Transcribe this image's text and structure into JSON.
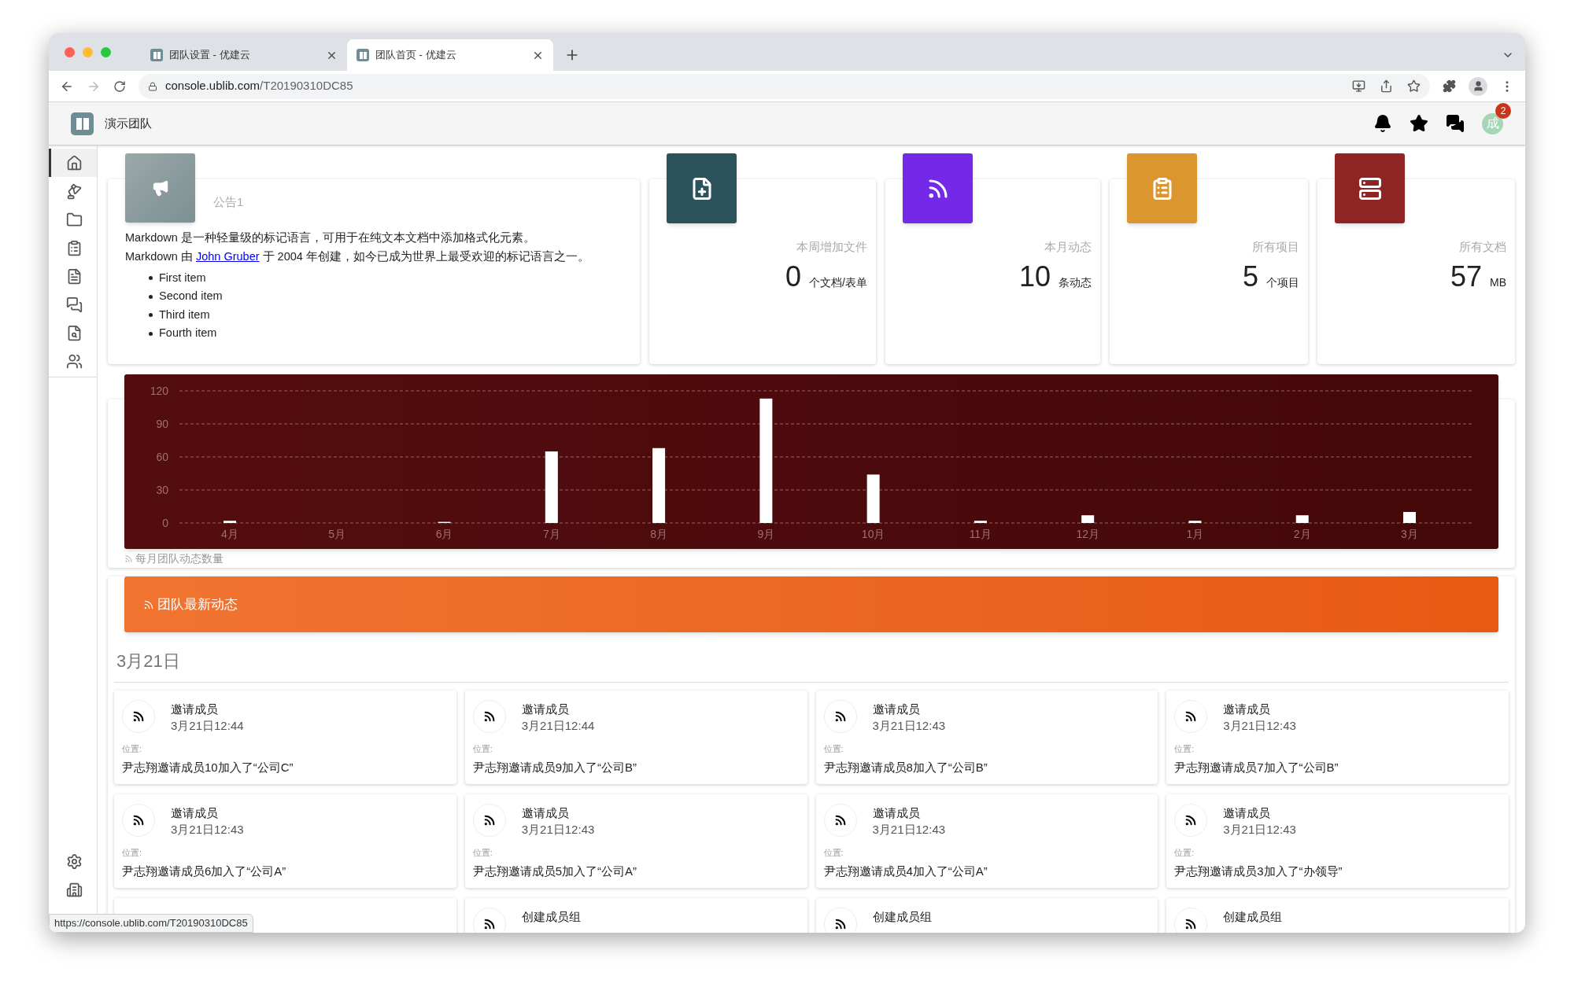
{
  "browser": {
    "tabs": [
      {
        "title": "团队设置 - 优建云",
        "selected": false
      },
      {
        "title": "团队首页 - 优建云",
        "selected": true
      }
    ],
    "url_host": "console.ublib.com",
    "url_path": "/T20190310DC85",
    "status_url": "https://console.ublib.com/T20190310DC85"
  },
  "app_header": {
    "team_name": "演示团队",
    "avatar": "成",
    "badge": "2"
  },
  "sidebar": {
    "items": [
      {
        "selected": true
      },
      {
        "selected": false
      },
      {
        "selected": false
      },
      {
        "selected": false
      },
      {
        "selected": false
      },
      {
        "selected": false
      },
      {
        "selected": false
      },
      {
        "selected": false
      }
    ],
    "bottom_items": [
      {
        "selected": false
      },
      {
        "selected": false
      }
    ]
  },
  "announcement": {
    "title": "公告1",
    "line_1": "Markdown 是一种轻量级的标记语言，可用于在纯文本文档中添加格式化元素。",
    "line_2_before": "Markdown 由 ",
    "line_2_link": "John Gruber",
    "line_2_after": " 于 2004 年创建，如今已成为世界上最受欢迎的标记语言之一。",
    "list": [
      "First item",
      "Second item",
      "Third item",
      "Fourth item"
    ]
  },
  "stats": [
    {
      "label": "本周增加文件",
      "value": "0",
      "unit": "个文档/表单",
      "color": "#2c525c"
    },
    {
      "label": "本月动态",
      "value": "10",
      "unit": "条动态",
      "color": "#7428e8"
    },
    {
      "label": "所有项目",
      "value": "5",
      "unit": "个项目",
      "color": "#dc962f"
    },
    {
      "label": "所有文档",
      "value": "57",
      "unit": "MB",
      "color": "#8e2424"
    }
  ],
  "activity_chart": {
    "caption": "每月团队动态数量",
    "chart_data": {
      "type": "bar",
      "categories": [
        "4月",
        "5月",
        "6月",
        "7月",
        "8月",
        "9月",
        "10月",
        "11月",
        "12月",
        "1月",
        "2月",
        "3月"
      ],
      "values": [
        2,
        0,
        1,
        65,
        68,
        113,
        44,
        2,
        7,
        2,
        7,
        10
      ],
      "ylim": [
        0,
        120
      ],
      "yticks": [
        0,
        30,
        60,
        90,
        120
      ],
      "grid": true
    }
  },
  "feed": {
    "title": "团队最新动态",
    "date": "3月21日",
    "items": [
      {
        "title": "邀请成员",
        "time": "3月21日12:44",
        "location_label": "位置:",
        "text": "尹志翔邀请成员10加入了“公司C”"
      },
      {
        "title": "邀请成员",
        "time": "3月21日12:44",
        "location_label": "位置:",
        "text": "尹志翔邀请成员9加入了“公司B”"
      },
      {
        "title": "邀请成员",
        "time": "3月21日12:43",
        "location_label": "位置:",
        "text": "尹志翔邀请成员8加入了“公司B”"
      },
      {
        "title": "邀请成员",
        "time": "3月21日12:43",
        "location_label": "位置:",
        "text": "尹志翔邀请成员7加入了“公司B”"
      },
      {
        "title": "邀请成员",
        "time": "3月21日12:43",
        "location_label": "位置:",
        "text": "尹志翔邀请成员6加入了“公司A”"
      },
      {
        "title": "邀请成员",
        "time": "3月21日12:43",
        "location_label": "位置:",
        "text": "尹志翔邀请成员5加入了“公司A”"
      },
      {
        "title": "邀请成员",
        "time": "3月21日12:43",
        "location_label": "位置:",
        "text": "尹志翔邀请成员4加入了“公司A”"
      },
      {
        "title": "邀请成员",
        "time": "3月21日12:43",
        "location_label": "位置:",
        "text": "尹志翔邀请成员3加入了“办领导”"
      },
      {
        "covered": true
      },
      {
        "title": "创建成员组"
      },
      {
        "title": "创建成员组"
      },
      {
        "title": "创建成员组"
      }
    ]
  }
}
